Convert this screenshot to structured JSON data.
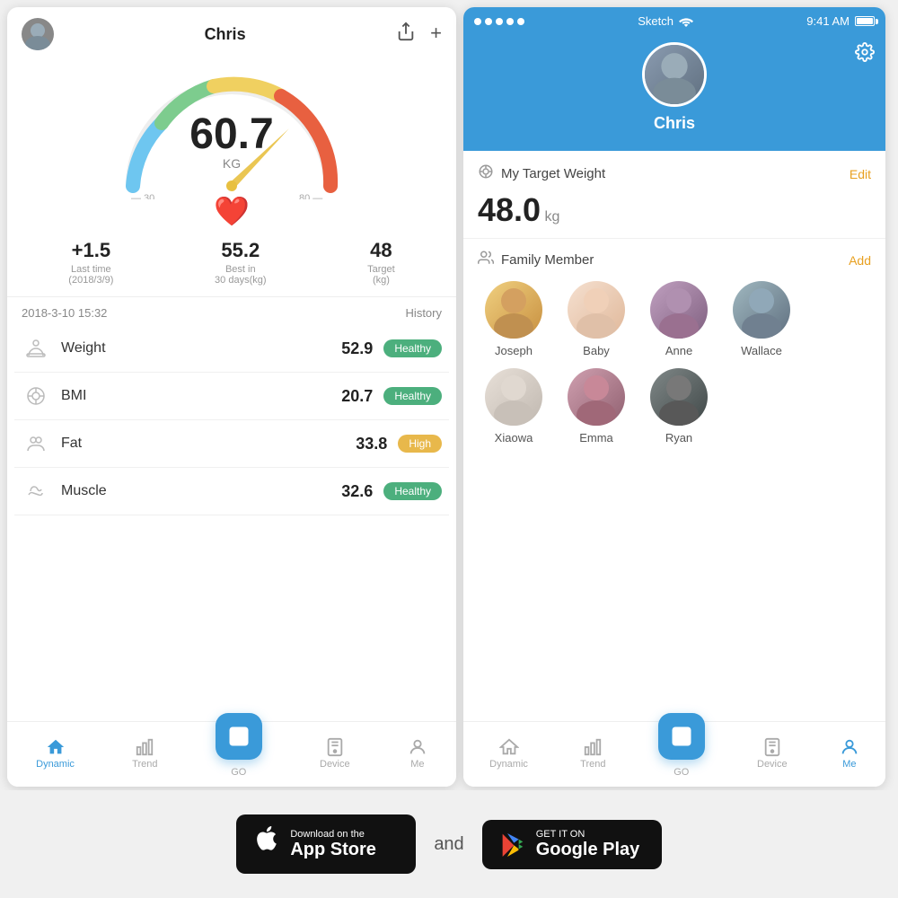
{
  "left_phone": {
    "header": {
      "name": "Chris",
      "share_icon": "↗",
      "add_icon": "+"
    },
    "gauge": {
      "value": "60.7",
      "unit": "KG",
      "min": "— 30",
      "max": "80 —"
    },
    "stats": [
      {
        "value": "+1.5",
        "label": "Last time\n(2018/3/9)"
      },
      {
        "value": "55.2",
        "label": "Best in\n30 days(kg)"
      },
      {
        "value": "48",
        "label": "Target\n(kg)"
      }
    ],
    "date": "2018-3-10 15:32",
    "history_label": "History",
    "measures": [
      {
        "icon": "⊙",
        "name": "Weight",
        "value": "52.9",
        "badge": "Healthy",
        "badge_type": "healthy"
      },
      {
        "icon": "◎",
        "name": "BMI",
        "value": "20.7",
        "badge": "Healthy",
        "badge_type": "healthy"
      },
      {
        "icon": "⍟",
        "name": "Fat",
        "value": "33.8",
        "badge": "High",
        "badge_type": "high"
      },
      {
        "icon": "♟",
        "name": "Muscle",
        "value": "32.6",
        "badge": "Healthy",
        "badge_type": "healthy"
      }
    ],
    "nav": [
      {
        "icon": "home",
        "label": "Dynamic",
        "active": true
      },
      {
        "icon": "trend",
        "label": "Trend",
        "active": false
      },
      {
        "icon": "go",
        "label": "GO",
        "active": false
      },
      {
        "icon": "device",
        "label": "Device",
        "active": false
      },
      {
        "icon": "me",
        "label": "Me",
        "active": false
      }
    ]
  },
  "right_phone": {
    "status_bar": {
      "dots": 5,
      "network": "Sketch",
      "wifi": true,
      "time": "9:41 AM",
      "battery": "100%"
    },
    "profile": {
      "name": "Chris",
      "gear_visible": true
    },
    "target_weight": {
      "title": "My Target Weight",
      "icon": "◎",
      "value": "48.0",
      "unit": "kg",
      "edit_label": "Edit"
    },
    "family": {
      "title": "Family Member",
      "add_label": "Add",
      "members": [
        {
          "name": "Joseph",
          "avatar_class": "avatar-joseph"
        },
        {
          "name": "Baby",
          "avatar_class": "avatar-baby"
        },
        {
          "name": "Anne",
          "avatar_class": "avatar-anne"
        },
        {
          "name": "Wallace",
          "avatar_class": "avatar-wallace"
        },
        {
          "name": "Xiaowa",
          "avatar_class": "avatar-xiaowa"
        },
        {
          "name": "Emma",
          "avatar_class": "avatar-emma"
        },
        {
          "name": "Ryan",
          "avatar_class": "avatar-ryan"
        }
      ]
    },
    "nav": [
      {
        "icon": "home",
        "label": "Dynamic",
        "active": false
      },
      {
        "icon": "trend",
        "label": "Trend",
        "active": false
      },
      {
        "icon": "go",
        "label": "GO",
        "active": false
      },
      {
        "icon": "device",
        "label": "Device",
        "active": false
      },
      {
        "icon": "me",
        "label": "Me",
        "active": true
      }
    ]
  },
  "bottom": {
    "app_store": {
      "top": "Download on the",
      "main": "App Store"
    },
    "and_text": "and",
    "google_play": {
      "top": "GET IT ON",
      "main": "Google Play"
    }
  }
}
